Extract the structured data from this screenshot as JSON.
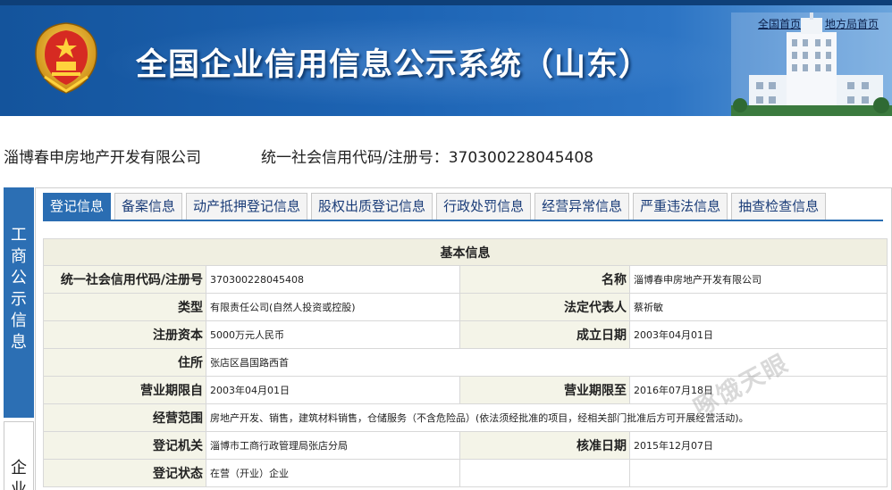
{
  "header": {
    "title": "全国企业信用信息公示系统（山东）",
    "links": {
      "home": "全国首页",
      "local": "地方局首页"
    }
  },
  "company": {
    "name": "淄博春申房地产开发有限公司",
    "code_label": "统一社会信用代码/注册号：",
    "code_value": "370300228045408"
  },
  "side_tabs": {
    "biz": "工商公示信息",
    "ent": "企业"
  },
  "tabs": [
    "登记信息",
    "备案信息",
    "动产抵押登记信息",
    "股权出质登记信息",
    "行政处罚信息",
    "经营异常信息",
    "严重违法信息",
    "抽查检查信息"
  ],
  "active_tab": "登记信息",
  "basic": {
    "section_title": "基本信息",
    "credit_code_label": "统一社会信用代码/注册号",
    "credit_code": "370300228045408",
    "name_label": "名称",
    "name": "淄博春申房地产开发有限公司",
    "type_label": "类型",
    "type": "有限责任公司(自然人投资或控股)",
    "legal_rep_label": "法定代表人",
    "legal_rep": "蔡祈敏",
    "capital_label": "注册资本",
    "capital": "5000万元人民币",
    "established_label": "成立日期",
    "established": "2003年04月01日",
    "address_label": "住所",
    "address": "张店区昌国路西首",
    "term_from_label": "营业期限自",
    "term_from": "2003年04月01日",
    "term_to_label": "营业期限至",
    "term_to": "2016年07月18日",
    "scope_label": "经营范围",
    "scope": "房地产开发、销售，建筑材料销售，仓储服务（不含危险品）(依法须经批准的项目，经相关部门批准后方可开展经营活动)。",
    "authority_label": "登记机关",
    "authority": "淄博市工商行政管理局张店分局",
    "approval_label": "核准日期",
    "approval": "2015年12月07日",
    "status_label": "登记状态",
    "status": "在营（开业）企业"
  },
  "watermark": "啄饿天眼",
  "colors": {
    "banner": "#1d64b4",
    "tab_active": "#2a6db2",
    "label_bg": "#f4f4e8",
    "side_tab": "#2c6fb4"
  }
}
